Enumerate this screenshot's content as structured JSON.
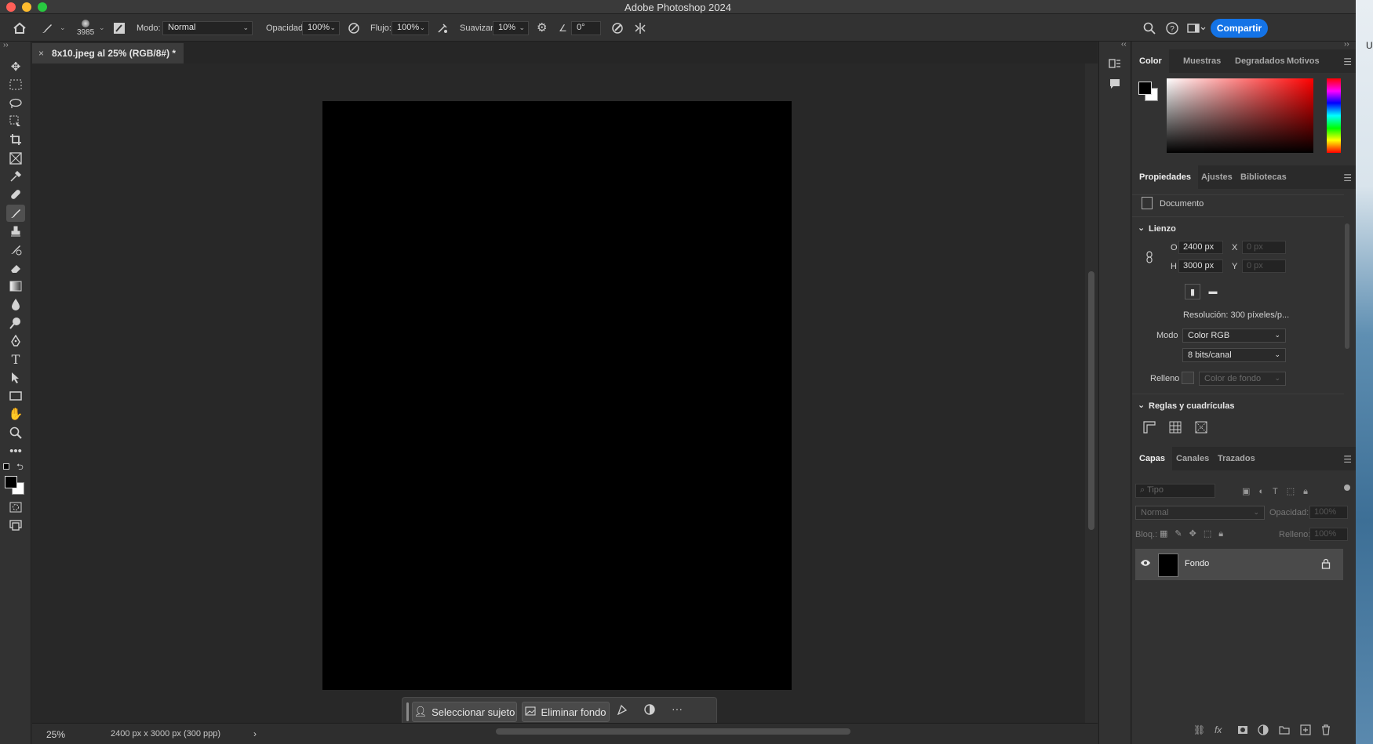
{
  "app": {
    "title": "Adobe Photoshop 2024"
  },
  "options_bar": {
    "brush_size": "3985",
    "mode_label": "Modo:",
    "mode_value": "Normal",
    "opacity_label": "Opacidad:",
    "opacity_value": "100%",
    "flow_label": "Flujo:",
    "flow_value": "100%",
    "smoothing_label": "Suavizar:",
    "smoothing_value": "10%",
    "angle_value": "0°",
    "share_label": "Compartir"
  },
  "document": {
    "tab_title": "8x10.jpeg al 25% (RGB/8#) *",
    "close": "×",
    "canvas_color": "#000000"
  },
  "taskbar": {
    "select_subject": "Seleccionar sujeto",
    "remove_bg": "Eliminar fondo",
    "more": "···"
  },
  "status": {
    "zoom": "25%",
    "info": "2400 px x 3000 px (300 ppp)",
    "arrow": "›"
  },
  "color_panel": {
    "tabs": [
      "Color",
      "Muestras",
      "Degradados",
      "Motivos"
    ],
    "fg": "#000000",
    "bg": "#ffffff"
  },
  "properties": {
    "tabs": [
      "Propiedades",
      "Ajustes",
      "Bibliotecas"
    ],
    "doc_label": "Documento",
    "canvas_header": "Lienzo",
    "w_label": "O",
    "w_value": "2400 px",
    "h_label": "H",
    "h_value": "3000 px",
    "x_label": "X",
    "x_value": "0 px",
    "y_label": "Y",
    "y_value": "0 px",
    "resolution": "Resolución: 300 píxeles/p...",
    "mode_label": "Modo",
    "mode_value": "Color RGB",
    "depth_value": "8 bits/canal",
    "fill_label": "Relleno",
    "fill_value": "Color de fondo",
    "rulers_header": "Reglas y cuadrículas"
  },
  "layers": {
    "tabs": [
      "Capas",
      "Canales",
      "Trazados"
    ],
    "search_placeholder": "Tipo",
    "blend_value": "Normal",
    "opacity_label": "Opacidad:",
    "opacity_value": "100%",
    "lock_label": "Bloq.:",
    "fill_label": "Relleno:",
    "fill_value": "100%",
    "items": [
      {
        "name": "Fondo",
        "visible": true,
        "locked": true
      }
    ]
  },
  "accent_color": "#1473e6"
}
